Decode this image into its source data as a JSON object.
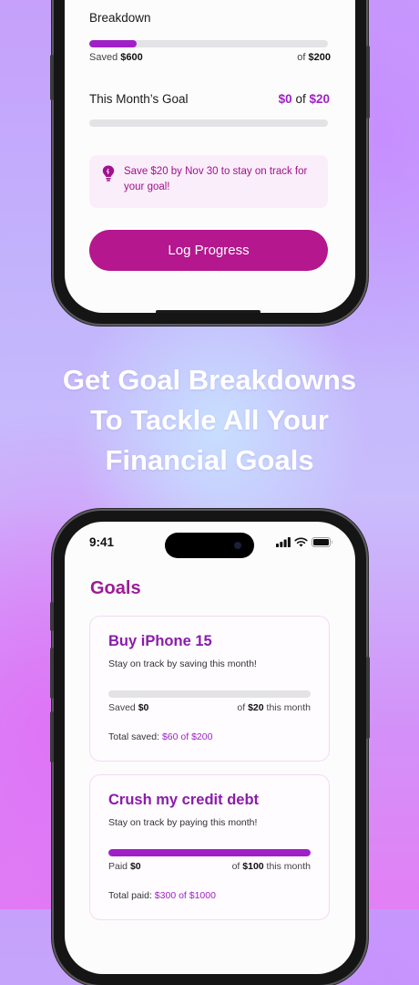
{
  "top_screen": {
    "breakdown_label": "Breakdown",
    "saved_label": "Saved",
    "saved_amount": "$600",
    "of_label": "of",
    "total_amount": "$200",
    "breakdown_progress": 0.2,
    "month_goal_label": "This Month’s Goal",
    "month_current": "$0",
    "month_of": "of",
    "month_target": "$20",
    "month_progress": 0,
    "tip_text": "Save $20 by Nov 30 to stay on track for your goal!",
    "log_button": "Log Progress"
  },
  "headline": {
    "line1": "Get Goal Breakdowns",
    "line2": "To Tackle All Your",
    "line3": "Financial Goals"
  },
  "bottom_screen": {
    "status_time": "9:41",
    "title": "Goals",
    "goals": [
      {
        "name": "Buy iPhone 15",
        "subtitle": "Stay on track by saving this month!",
        "left_label": "Saved",
        "left_amount": "$0",
        "right_prefix": "of",
        "right_amount": "$20",
        "right_suffix": "this month",
        "progress": 0,
        "total_label": "Total saved:",
        "total_value": "$60 of $200"
      },
      {
        "name": "Crush my credit debt",
        "subtitle": "Stay on track by paying this month!",
        "left_label": "Paid",
        "left_amount": "$0",
        "right_prefix": "of",
        "right_amount": "$100",
        "right_suffix": "this month",
        "progress": 1,
        "total_label": "Total paid:",
        "total_value": "$300 of $1000"
      }
    ]
  },
  "colors": {
    "accent": "#a020c8",
    "button": "#b4178e",
    "title": "#9b1e96"
  },
  "icons": {
    "tip": "lightbulb-icon",
    "signal": "signal-icon",
    "wifi": "wifi-icon",
    "battery": "battery-icon"
  }
}
